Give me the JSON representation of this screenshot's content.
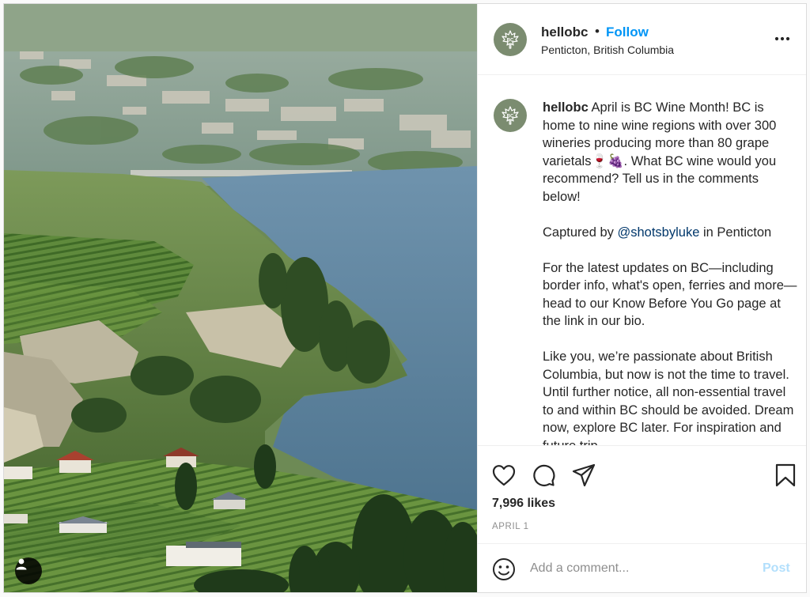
{
  "post": {
    "username": "hellobc",
    "follow_label": "Follow",
    "separator": "•",
    "location": "Penticton, British Columbia",
    "caption": {
      "username": "hellobc",
      "paragraphs": [
        "April is BC Wine Month! BC is home to nine wine regions with over 300 wineries producing more than 80 grape varietals🍷🍇. What BC wine would you recommend? Tell us in the comments below!",
        "Captured by",
        "For the latest updates on BC—including border info, what's open, ferries and more—head to our Know Before You Go page at the link in our bio.",
        "Like you, we’re passionate about British Columbia, but now is not the time to travel. Until further notice, all non-essential travel to and within BC should be avoided. Dream now, explore BC later. For inspiration and future trip"
      ],
      "mention": "@shotsbyluke",
      "mention_suffix": "in Penticton"
    },
    "likes": "7,996 likes",
    "date": "APRIL 1",
    "comment_placeholder": "Add a comment...",
    "post_label": "Post"
  },
  "icons": {
    "like": "heart-icon",
    "comment": "comment-bubble-icon",
    "share": "paper-plane-icon",
    "save": "bookmark-icon",
    "more": "more-options-icon",
    "emoji": "smiley-icon",
    "user_tag": "user-icon",
    "avatar": "maple-leaf-logo"
  },
  "colors": {
    "link": "#0095f6",
    "mention": "#00376b",
    "muted": "#8e8e8e",
    "post_disabled": "#b2dffc",
    "avatar_bg": "#7b8c70"
  }
}
